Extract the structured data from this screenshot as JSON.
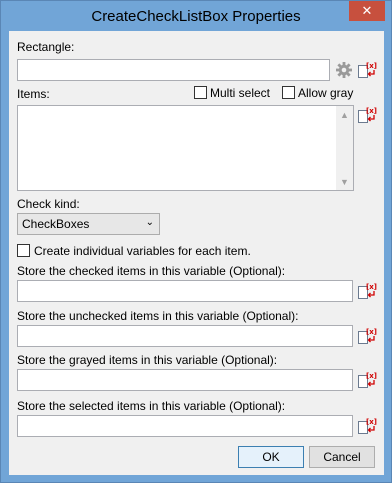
{
  "window": {
    "title": "CreateCheckListBox Properties",
    "close_glyph": "✕"
  },
  "rectangle": {
    "label": "Rectangle:",
    "value": ""
  },
  "items": {
    "label": "Items:",
    "value": ""
  },
  "multi_select": {
    "label": "Multi select",
    "checked": false
  },
  "allow_gray": {
    "label": "Allow gray",
    "checked": false
  },
  "check_kind": {
    "label": "Check kind:",
    "selected": "CheckBoxes"
  },
  "create_individual": {
    "label": "Create individual variables for each item.",
    "checked": false
  },
  "checked_var": {
    "label": "Store the checked items in this variable (Optional):",
    "value": ""
  },
  "unchecked_var": {
    "label": "Store the unchecked items in this variable (Optional):",
    "value": ""
  },
  "grayed_var": {
    "label": "Store the grayed items in this variable (Optional):",
    "value": ""
  },
  "selected_var": {
    "label": "Store the selected items in this variable (Optional):",
    "value": ""
  },
  "buttons": {
    "ok": "OK",
    "cancel": "Cancel"
  },
  "icons": {
    "gear": "gear-icon",
    "variable": "variable-icon",
    "close": "close-icon"
  },
  "colors": {
    "title_bar": "#71a5d7",
    "close_button": "#c7503e",
    "client_bg": "#f0f0f0",
    "variable_icon_accent": "#d00000"
  }
}
